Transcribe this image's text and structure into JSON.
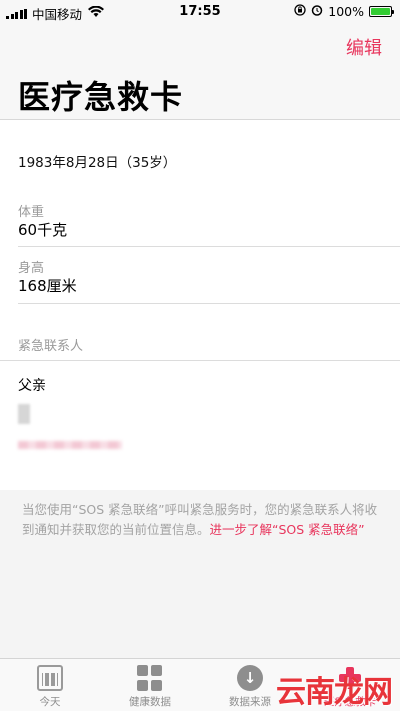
{
  "status_bar": {
    "carrier": "中国移动",
    "time": "17:55",
    "battery": "100%",
    "battery_level": 1.0
  },
  "nav": {
    "edit_label": "编辑",
    "title": "医疗急救卡"
  },
  "content": {
    "dob": "1983年8月28日（35岁）",
    "weight_label": "体重",
    "weight_value": "60千克",
    "height_label": "身高",
    "height_value": "168厘米",
    "emergency_contacts_label": "紧急联系人",
    "contact_relation": "父亲"
  },
  "footnote": {
    "text": "当您使用“SOS 紧急联络”呼叫紧急服务时，您的紧急联系人将收到通知并获取您的当前位置信息。",
    "link": "进一步了解“SOS 紧急联络”"
  },
  "tabbar": {
    "tabs": [
      {
        "label": "今天",
        "icon": "calendar-icon"
      },
      {
        "label": "健康数据",
        "icon": "grid-icon"
      },
      {
        "label": "数据来源",
        "icon": "download-icon"
      },
      {
        "label": "医疗急救卡",
        "icon": "medical-id-icon"
      }
    ]
  },
  "watermark": "云南龙网",
  "colors": {
    "accent": "#e8365d",
    "secondary_text": "#9a9a9a"
  }
}
